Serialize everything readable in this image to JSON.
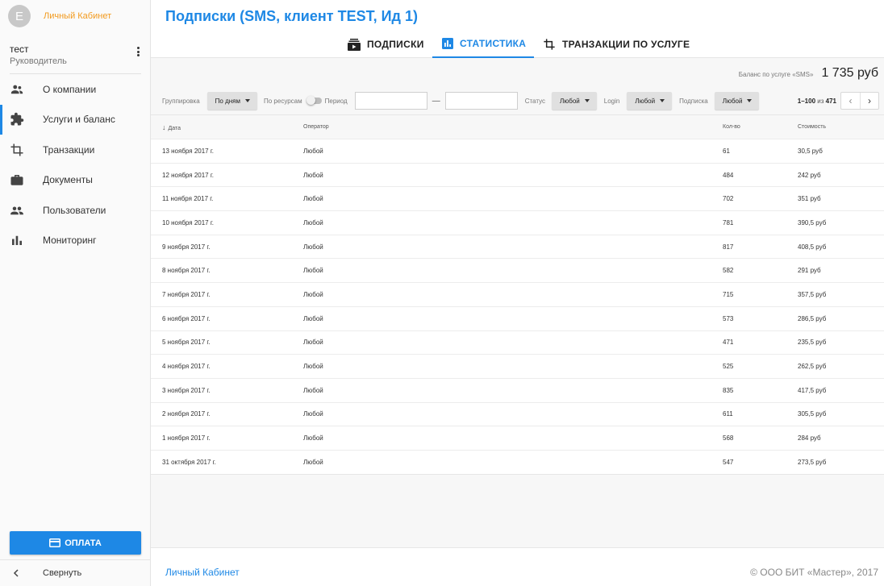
{
  "app": {
    "avatar_letter": "E",
    "cabinet_title": "Личный Кабинет"
  },
  "user": {
    "name": "тест",
    "role": "Руководитель"
  },
  "nav": [
    {
      "label": "О компании",
      "icon": "people-icon"
    },
    {
      "label": "Услуги и баланс",
      "icon": "puzzle-icon",
      "active": true
    },
    {
      "label": "Транзакции",
      "icon": "crop-icon"
    },
    {
      "label": "Документы",
      "icon": "briefcase-icon"
    },
    {
      "label": "Пользователи",
      "icon": "group-icon"
    },
    {
      "label": "Мониторинг",
      "icon": "bar-chart-icon"
    }
  ],
  "pay_button": "ОПЛАТА",
  "collapse_label": "Свернуть",
  "page_title": "Подписки (SMS, клиент TEST, Ид 1)",
  "tabs": [
    {
      "label": "ПОДПИСКИ",
      "icon": "subscriptions-icon"
    },
    {
      "label": "СТАТИСТИКА",
      "icon": "stats-icon",
      "active": true
    },
    {
      "label": "ТРАНЗАКЦИИ ПО УСЛУГЕ",
      "icon": "crop-icon"
    }
  ],
  "balance": {
    "label": "Баланс по услуге «SMS»",
    "value": "1 735 руб"
  },
  "filters": {
    "grouping_label": "Группировка",
    "grouping_value": "По дням",
    "by_resources_label": "По ресурсам",
    "period_label": "Период",
    "date_separator": "—",
    "status_label": "Статус",
    "status_value": "Любой",
    "login_label": "Login",
    "login_value": "Любой",
    "subscription_label": "Подписка",
    "subscription_value": "Любой"
  },
  "pager": {
    "range": "1–100",
    "of": "из",
    "total": "471",
    "prev": "‹",
    "next": "›"
  },
  "table": {
    "columns": [
      "Дата",
      "Оператор",
      "Кол-во",
      "Стоимость"
    ],
    "sort_arrow": "↓",
    "rows": [
      [
        "13 ноября 2017 г.",
        "Любой",
        "61",
        "30,5 руб"
      ],
      [
        "12 ноября 2017 г.",
        "Любой",
        "484",
        "242 руб"
      ],
      [
        "11 ноября 2017 г.",
        "Любой",
        "702",
        "351 руб"
      ],
      [
        "10 ноября 2017 г.",
        "Любой",
        "781",
        "390,5 руб"
      ],
      [
        "9 ноября 2017 г.",
        "Любой",
        "817",
        "408,5 руб"
      ],
      [
        "8 ноября 2017 г.",
        "Любой",
        "582",
        "291 руб"
      ],
      [
        "7 ноября 2017 г.",
        "Любой",
        "715",
        "357,5 руб"
      ],
      [
        "6 ноября 2017 г.",
        "Любой",
        "573",
        "286,5 руб"
      ],
      [
        "5 ноября 2017 г.",
        "Любой",
        "471",
        "235,5 руб"
      ],
      [
        "4 ноября 2017 г.",
        "Любой",
        "525",
        "262,5 руб"
      ],
      [
        "3 ноября 2017 г.",
        "Любой",
        "835",
        "417,5 руб"
      ],
      [
        "2 ноября 2017 г.",
        "Любой",
        "611",
        "305,5 руб"
      ],
      [
        "1 ноября 2017 г.",
        "Любой",
        "568",
        "284 руб"
      ],
      [
        "31 октября 2017 г.",
        "Любой",
        "547",
        "273,5 руб"
      ]
    ]
  },
  "footer": {
    "left": "Личный Кабинет",
    "right": "© ООО БИТ «Мастер», 2017"
  },
  "colors": {
    "accent": "#1e88e5",
    "brand": "#f29a1d"
  }
}
